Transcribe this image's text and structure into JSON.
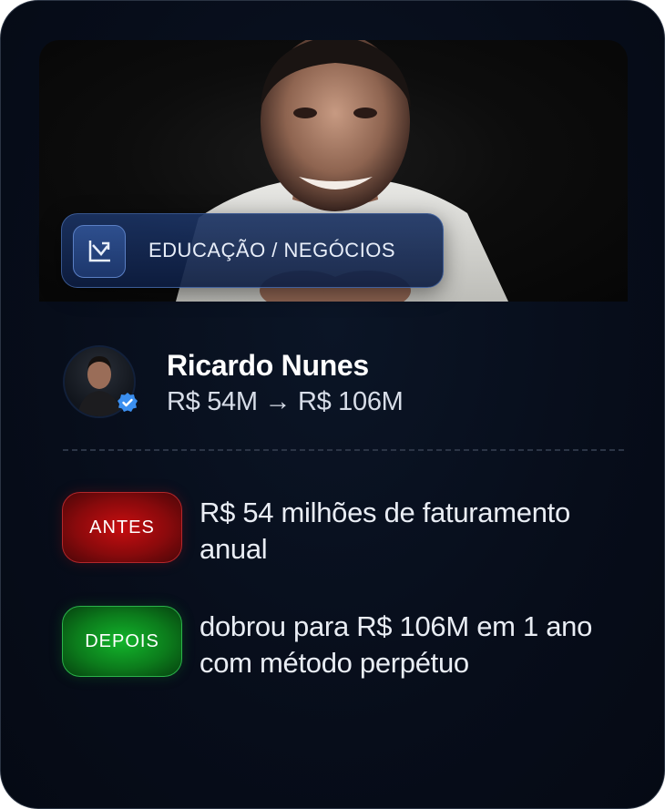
{
  "category": {
    "label": "EDUCAÇÃO / NEGÓCIOS",
    "icon": "chart-growth-icon"
  },
  "profile": {
    "name": "Ricardo Nunes",
    "growth": "R$ 54M → R$ 106M",
    "verified": true
  },
  "comparison": {
    "before": {
      "tag": "ANTES",
      "description": "R$ 54 milhões de faturamento anual",
      "color": "#c80d10"
    },
    "after": {
      "tag": "DEPOIS",
      "description": "dobrou para R$ 106M em 1 ano com método perpétuo",
      "color": "#12b52b"
    }
  },
  "colors": {
    "card_background": "#070d1a",
    "accent_blue": "#1d376c",
    "verified_blue": "#3b8ff0"
  }
}
